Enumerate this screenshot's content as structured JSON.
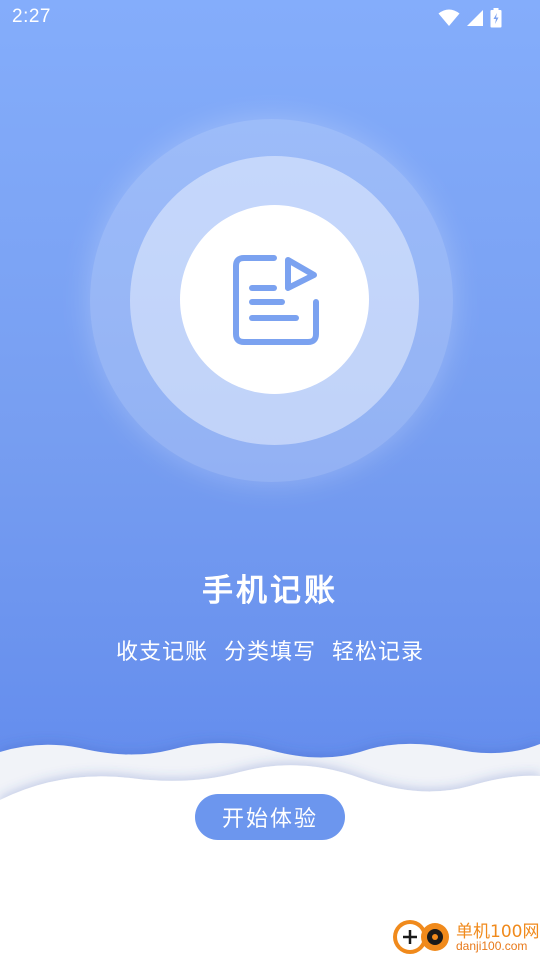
{
  "status_bar": {
    "time": "2:27",
    "icons": [
      "wifi-icon",
      "cell-signal-icon",
      "battery-charging-icon"
    ]
  },
  "hero": {
    "icon": "note-document-icon",
    "accent_color": "#7ba2f0"
  },
  "title": "手机记账",
  "subtitle": "收支记账  分类填写  轻松记录",
  "start_button": {
    "label": "开始体验"
  },
  "watermark": {
    "text": "单机100网",
    "url_text": "danji100.com"
  },
  "colors": {
    "background_top": "#84adfb",
    "background_bottom": "#5f88e8",
    "button": "#6c96ee",
    "watermark": "#f08a1c"
  }
}
